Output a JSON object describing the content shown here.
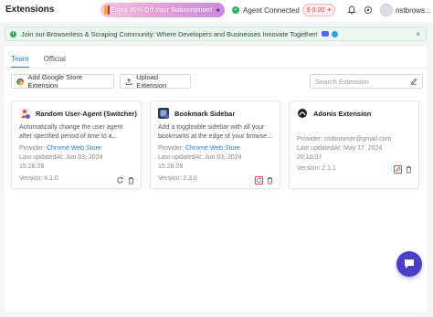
{
  "header": {
    "title": "Extensions",
    "promo": "Enjoy 90% Off Your Subscription!",
    "agent_status": "Agent Connected",
    "balance": "$ 0.00",
    "username": "nstbrows..."
  },
  "banner": {
    "text": "Join our Browserless & Scraping Community: Where Developers and Businesses Innovate Together!"
  },
  "tabs": [
    {
      "label": "Team",
      "active": true
    },
    {
      "label": "Official",
      "active": false
    }
  ],
  "toolbar": {
    "add_label": "Add Google Store Extension",
    "upload_label": "Upload Extension",
    "search_placeholder": "Search Extension"
  },
  "cards": [
    {
      "name": "Random User-Agent (Switcher)",
      "description": "Automatically change the user agent after specified period of time to a...",
      "provider_label": "Provider:",
      "provider": "Chrome Web Store",
      "updated_label": "Last updatedAt:",
      "updated": "Jun 03, 2024",
      "updated_time": "15:28:28",
      "version_label": "Version:",
      "version": "4.1.0"
    },
    {
      "name": "Bookmark Sidebar",
      "description": "Add a toggleable sidebar with all your bookmarks at the edge of your browse...",
      "provider_label": "Provider:",
      "provider": "Chrome Web Store",
      "updated_label": "Last updatedAt:",
      "updated": "Jun 03, 2024",
      "updated_time": "15:28:28",
      "version_label": "Version:",
      "version": "2.3.0"
    },
    {
      "name": "Adonis Extension",
      "description": "",
      "provider_label": "Provider:",
      "provider": "nstbrowser@gmail.com",
      "updated_label": "Last updatedAt:",
      "updated": "May 17, 2024",
      "updated_time": "20:10:07",
      "version_label": "Version:",
      "version": "2.1.1"
    }
  ],
  "colors": {
    "accent": "#2a7bd4",
    "success": "#2eaf5e",
    "danger": "#e5484d",
    "fab": "#4b3fc6"
  }
}
